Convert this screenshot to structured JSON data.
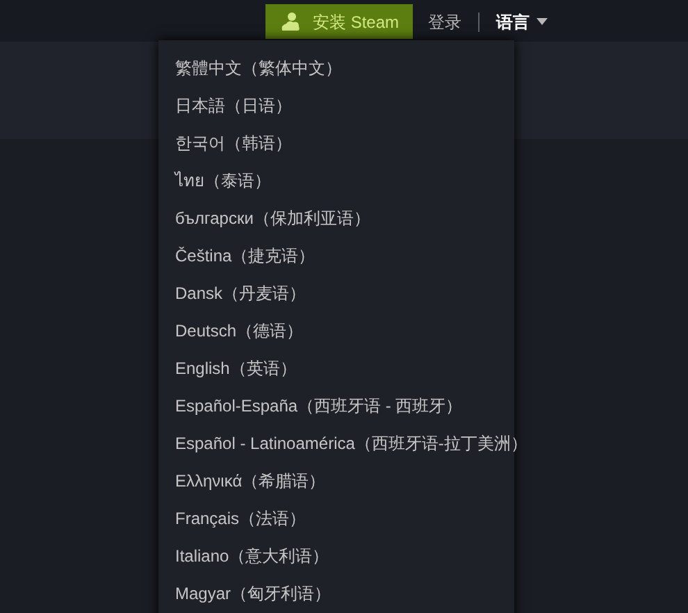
{
  "header": {
    "install_button": "安装 Steam",
    "login_link": "登录",
    "language_menu": {
      "label": "语言",
      "expanded": true
    }
  },
  "languages": [
    {
      "label": "繁體中文（繁体中文）"
    },
    {
      "label": "日本語（日语）"
    },
    {
      "label": "한국어（韩语）"
    },
    {
      "label": "ไทย（泰语）"
    },
    {
      "label": "български（保加利亚语）"
    },
    {
      "label": "Čeština（捷克语）"
    },
    {
      "label": "Dansk（丹麦语）"
    },
    {
      "label": "Deutsch（德语）"
    },
    {
      "label": "English（英语）"
    },
    {
      "label": "Español-España（西班牙语 - 西班牙）"
    },
    {
      "label": "Español - Latinoamérica（西班牙语-拉丁美洲）"
    },
    {
      "label": "Ελληνικά（希腊语）"
    },
    {
      "label": "Français（法语）"
    },
    {
      "label": "Italiano（意大利语）"
    },
    {
      "label": "Magyar（匈牙利语）"
    }
  ]
}
